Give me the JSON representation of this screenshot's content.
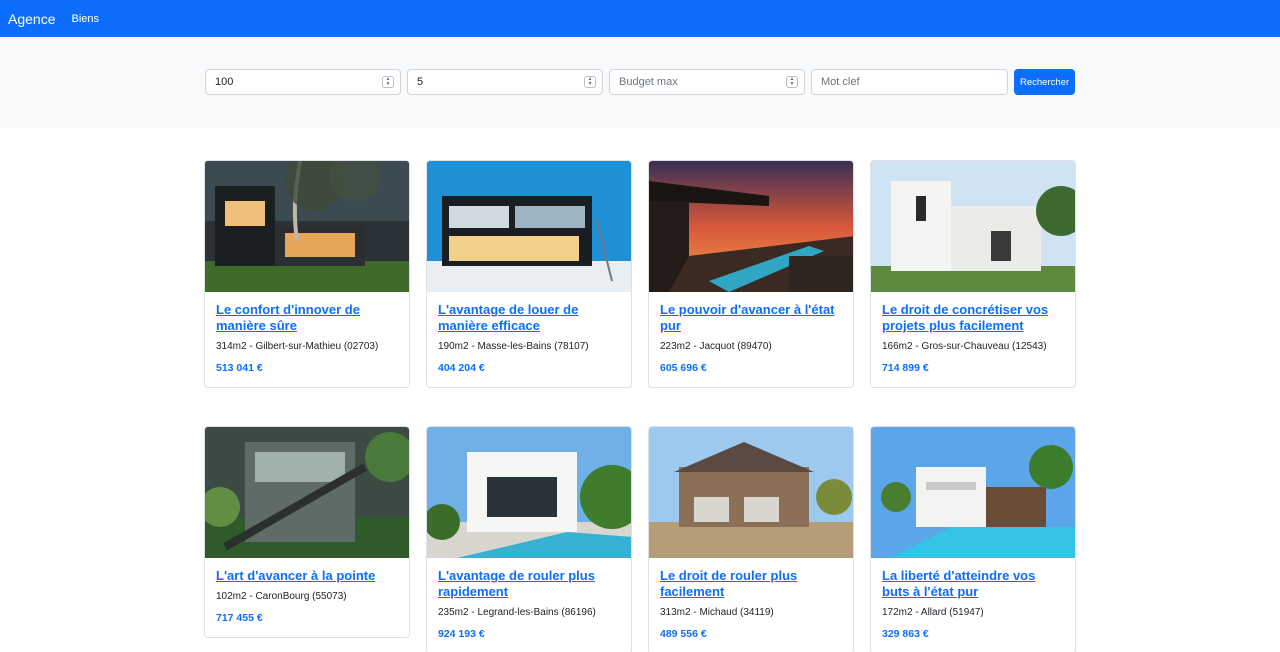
{
  "navbar": {
    "brand": "Agence",
    "link": "Biens"
  },
  "search": {
    "surface": "100",
    "rooms": "5",
    "budget_placeholder": "Budget max",
    "keyword_placeholder": "Mot clef",
    "button": "Rechercher"
  },
  "listings": [
    {
      "title": "Le confort d'innover de manière sûre",
      "meta": "314m2 - Gilbert-sur-Mathieu (02703)",
      "price": "513 041 €"
    },
    {
      "title": "L'avantage de louer de manière efficace",
      "meta": "190m2 - Masse-les-Bains (78107)",
      "price": "404 204 €"
    },
    {
      "title": "Le pouvoir d'avancer à l'état pur",
      "meta": "223m2 - Jacquot (89470)",
      "price": "605 696 €"
    },
    {
      "title": "Le droit de concrétiser vos projets plus facilement",
      "meta": "166m2 - Gros-sur-Chauveau (12543)",
      "price": "714 899 €"
    },
    {
      "title": "L'art d'avancer à la pointe",
      "meta": "102m2 - CaronBourg (55073)",
      "price": "717 455 €"
    },
    {
      "title": "L'avantage de rouler plus rapidement",
      "meta": "235m2 - Legrand-les-Bains (86196)",
      "price": "924 193 €"
    },
    {
      "title": "Le droit de rouler plus facilement",
      "meta": "313m2 - Michaud (34119)",
      "price": "489 556 €"
    },
    {
      "title": "La liberté d'atteindre vos buts à l'état pur",
      "meta": "172m2 - Allard (51947)",
      "price": "329 863 €"
    }
  ]
}
